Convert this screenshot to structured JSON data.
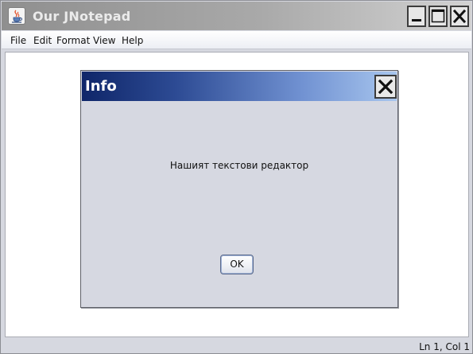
{
  "window": {
    "title": "Our JNotepad",
    "icon": "java-cup-icon",
    "controls": [
      "minimize-icon",
      "maximize-icon",
      "close-icon"
    ]
  },
  "menubar": {
    "items": [
      {
        "label": "File"
      },
      {
        "label": "Edit"
      },
      {
        "label": "Format"
      },
      {
        "label": "View"
      },
      {
        "label": "Help"
      }
    ]
  },
  "statusbar": {
    "position": "Ln 1, Col 1"
  },
  "dialog": {
    "title": "Info",
    "message": "Нашият текстови редактор",
    "ok_label": "OK",
    "title_gradient": [
      "#0f2669",
      "#a8c6ee"
    ]
  }
}
